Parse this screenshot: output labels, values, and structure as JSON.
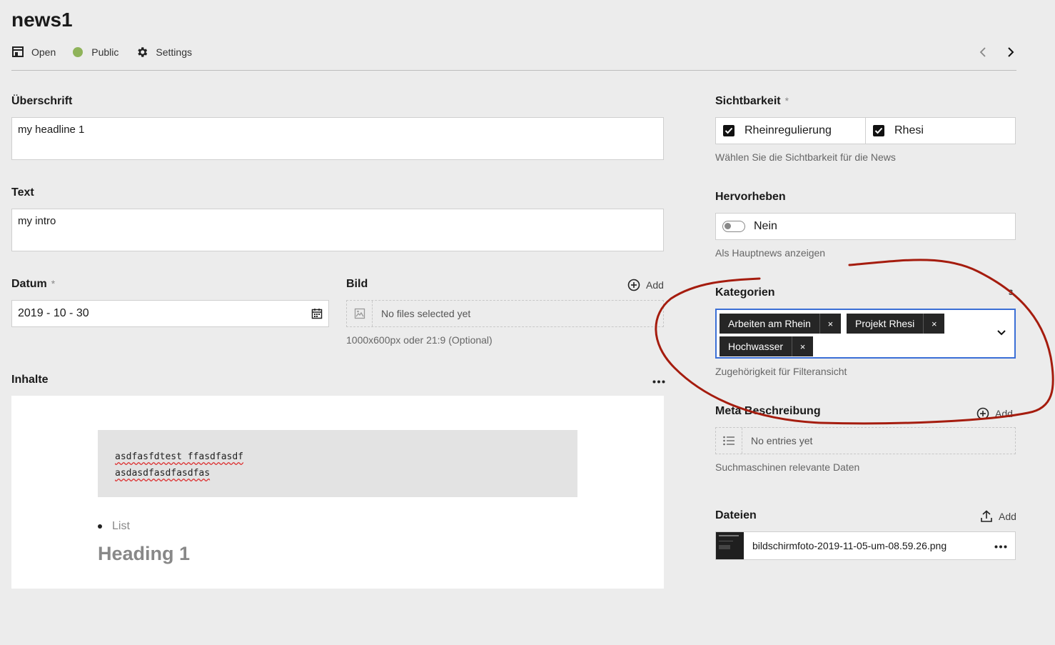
{
  "header": {
    "title": "news1",
    "open_label": "Open",
    "public_label": "Public",
    "settings_label": "Settings"
  },
  "fields": {
    "ueberschrift": {
      "label": "Überschrift",
      "value": "my headline 1"
    },
    "text": {
      "label": "Text",
      "value": "my intro"
    },
    "datum": {
      "label": "Datum",
      "required": "*",
      "value": "2019 - 10 - 30"
    },
    "bild": {
      "label": "Bild",
      "add_label": "Add",
      "empty": "No files selected yet",
      "help": "1000x600px oder 21:9 (Optional)"
    },
    "inhalte": {
      "label": "Inhalte",
      "code_line1": "asdfasfdtest ffasdfasdf",
      "code_line2": "asdasdfasdfasdfas",
      "list_item": "List",
      "heading": "Heading 1"
    }
  },
  "sidebar": {
    "sichtbarkeit": {
      "label": "Sichtbarkeit",
      "required": "*",
      "options": [
        "Rheinregulierung",
        "Rhesi"
      ],
      "help": "Wählen Sie die Sichtbarkeit für die News"
    },
    "hervorheben": {
      "label": "Hervorheben",
      "toggle_label": "Nein",
      "help": "Als Hauptnews anzeigen"
    },
    "kategorien": {
      "label": "Kategorien",
      "count": "3",
      "tags": [
        "Arbeiten am Rhein",
        "Projekt Rhesi",
        "Hochwasser"
      ],
      "remove_glyph": "×",
      "help": "Zugehörigkeit für Filteransicht"
    },
    "meta": {
      "label": "Meta Beschreibung",
      "add_label": "Add",
      "empty": "No entries yet",
      "help": "Suchmaschinen relevante Daten"
    },
    "dateien": {
      "label": "Dateien",
      "add_label": "Add",
      "filename": "bildschirmfoto-2019-11-05-um-08.59.26.png"
    }
  },
  "colors": {
    "background": "#ececec",
    "status_public": "#8fb35a",
    "tag_bg": "#262626",
    "focus_border": "#3b6fd6",
    "annotation_red": "#a51c0e"
  },
  "icons": [
    "open-icon",
    "gear-icon",
    "chevron-left-icon",
    "chevron-right-icon",
    "calendar-icon",
    "image-icon",
    "plus-circle-icon",
    "list-icon",
    "upload-icon",
    "more-icon",
    "chevron-down-icon",
    "checkmark-icon",
    "toggle-icon",
    "close-icon"
  ]
}
